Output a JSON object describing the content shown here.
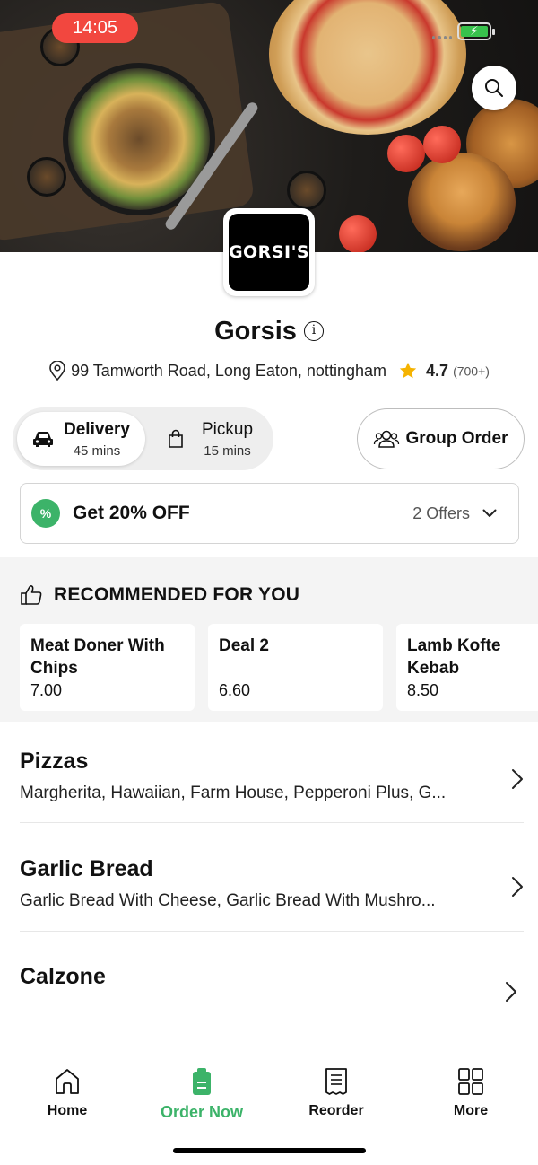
{
  "status_bar": {
    "time": "14:05"
  },
  "restaurant": {
    "logo_text": "GORSI'S",
    "name": "Gorsis",
    "address": "99 Tamworth Road, Long Eaton, nottingham",
    "rating": "4.7",
    "rating_count": "(700+)"
  },
  "order_mode": {
    "delivery": {
      "label": "Delivery",
      "time": "45 mins",
      "selected": true
    },
    "pickup": {
      "label": "Pickup",
      "time": "15 mins",
      "selected": false
    }
  },
  "group_order": {
    "label": "Group Order"
  },
  "offers": {
    "badge": "%",
    "title": "Get 20% OFF",
    "count": "2 Offers"
  },
  "recommended": {
    "title": "RECOMMENDED FOR YOU",
    "items": [
      {
        "name": "Meat Doner With Chips",
        "price": "7.00"
      },
      {
        "name": "Deal 2",
        "price": "6.60"
      },
      {
        "name": "Lamb Kofte Kebab",
        "price": "8.50"
      }
    ]
  },
  "categories": [
    {
      "title": "Pizzas",
      "desc": "Margherita, Hawaiian, Farm House, Pepperoni Plus, G..."
    },
    {
      "title": "Garlic Bread",
      "desc": "Garlic Bread With Cheese, Garlic Bread With Mushro..."
    },
    {
      "title": "Calzone",
      "desc": ""
    }
  ],
  "tabs": [
    {
      "label": "Home",
      "icon": "home-icon"
    },
    {
      "label": "Order Now",
      "icon": "order-icon",
      "active": true
    },
    {
      "label": "Reorder",
      "icon": "receipt-icon"
    },
    {
      "label": "More",
      "icon": "grid-icon"
    }
  ],
  "colors": {
    "accent": "#3cb369",
    "time_pill": "#f2473f",
    "star": "#f5b301"
  }
}
